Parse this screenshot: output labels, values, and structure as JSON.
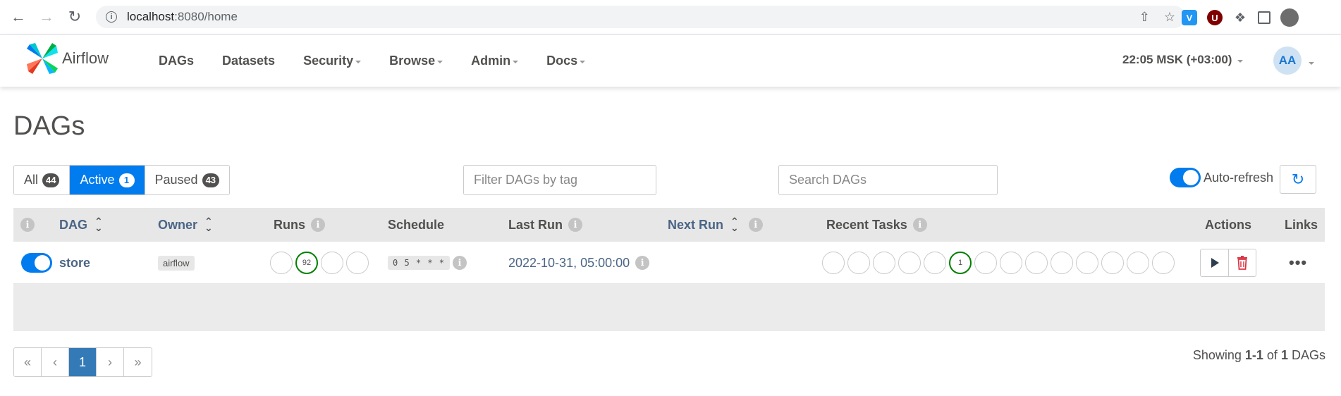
{
  "browser": {
    "url_host": "localhost",
    "url_path": ":8080/home"
  },
  "navbar": {
    "brand": "Airflow",
    "items": [
      "DAGs",
      "Datasets",
      "Security",
      "Browse",
      "Admin",
      "Docs"
    ],
    "clock": "22:05 MSK (+03:00)",
    "avatar": "AA"
  },
  "page": {
    "title": "DAGs"
  },
  "filters": {
    "all_label": "All",
    "all_count": "44",
    "active_label": "Active",
    "active_count": "1",
    "paused_label": "Paused",
    "paused_count": "43",
    "tag_placeholder": "Filter DAGs by tag",
    "search_placeholder": "Search DAGs",
    "auto_refresh": "Auto-refresh"
  },
  "table": {
    "headers": {
      "info": "i",
      "dag": "DAG",
      "owner": "Owner",
      "runs": "Runs",
      "schedule": "Schedule",
      "last_run": "Last Run",
      "next_run": "Next Run",
      "recent_tasks": "Recent Tasks",
      "actions": "Actions",
      "links": "Links"
    },
    "rows": [
      {
        "dag": "store",
        "owner": "airflow",
        "runs": [
          "",
          "92",
          "",
          ""
        ],
        "schedule": "0 5 * * *",
        "last_run": "2022-10-31, 05:00:00",
        "next_run": "",
        "recent_tasks": [
          "",
          "",
          "",
          "",
          "",
          "1",
          "",
          "",
          "",
          "",
          "",
          "",
          "",
          "",
          ""
        ],
        "links": "•••"
      }
    ]
  },
  "pagination": {
    "first": "«",
    "prev": "‹",
    "current": "1",
    "next": "›",
    "last": "»",
    "showing_prefix": "Showing",
    "range": "1-1",
    "of": "of",
    "total": "1",
    "suffix": "DAGs"
  },
  "colors": {
    "accent": "#017cee",
    "success": "#008000",
    "danger": "#dc3545",
    "link": "#4b6585"
  }
}
